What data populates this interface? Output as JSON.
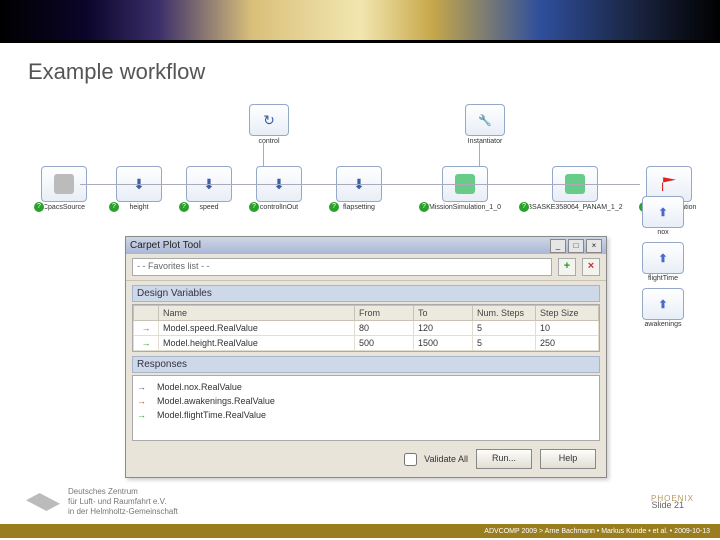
{
  "slide": {
    "title": "Example workflow",
    "number_label": "Slide 21",
    "footer_bar": "ADVCOMP 2009 > Arne Bachmann • Markus Kunde • et al. • 2009-10-13",
    "affiliation_line1": "Deutsches Zentrum",
    "affiliation_line2": "für Luft- und Raumfahrt e.V.",
    "affiliation_line3": "in der Helmholtz-Gemeinschaft",
    "phoenix": "PHOENIX"
  },
  "workflow": {
    "top": [
      {
        "label": "control"
      },
      {
        "label": "Instantiator"
      }
    ],
    "row": [
      {
        "label": "CpacsSource"
      },
      {
        "label": "height"
      },
      {
        "label": "speed"
      },
      {
        "label": "controlInOut"
      },
      {
        "label": "flapsetting"
      },
      {
        "label": "MissionSimulation_1_0"
      },
      {
        "label": "BSASKE358064_PANAM_1_2"
      },
      {
        "label": "CpacsDestination"
      }
    ],
    "outputs": [
      {
        "label": "nox"
      },
      {
        "label": "flightTime"
      },
      {
        "label": "awakenings"
      }
    ]
  },
  "dialog": {
    "title": "Carpet Plot Tool",
    "favorites_placeholder": "- - Favorites list - -",
    "sections": {
      "design": "Design Variables",
      "responses": "Responses"
    },
    "columns": {
      "name": "Name",
      "from": "From",
      "to": "To",
      "num_steps": "Num. Steps",
      "step_size": "Step Size"
    },
    "design_rows": [
      {
        "name": "Model.speed.RealValue",
        "from": "80",
        "to": "120",
        "steps": "5",
        "size": "10"
      },
      {
        "name": "Model.height.RealValue",
        "from": "500",
        "to": "1500",
        "steps": "5",
        "size": "250"
      }
    ],
    "response_rows": [
      {
        "color": "#3b5fa8",
        "name": "Model.nox.RealValue"
      },
      {
        "color": "#c34a1a",
        "name": "Model.awakenings.RealValue"
      },
      {
        "color": "#2a9a2a",
        "name": "Model.flightTime.RealValue"
      }
    ],
    "validate_label": "Validate All",
    "run_label": "Run...",
    "help_label": "Help"
  }
}
